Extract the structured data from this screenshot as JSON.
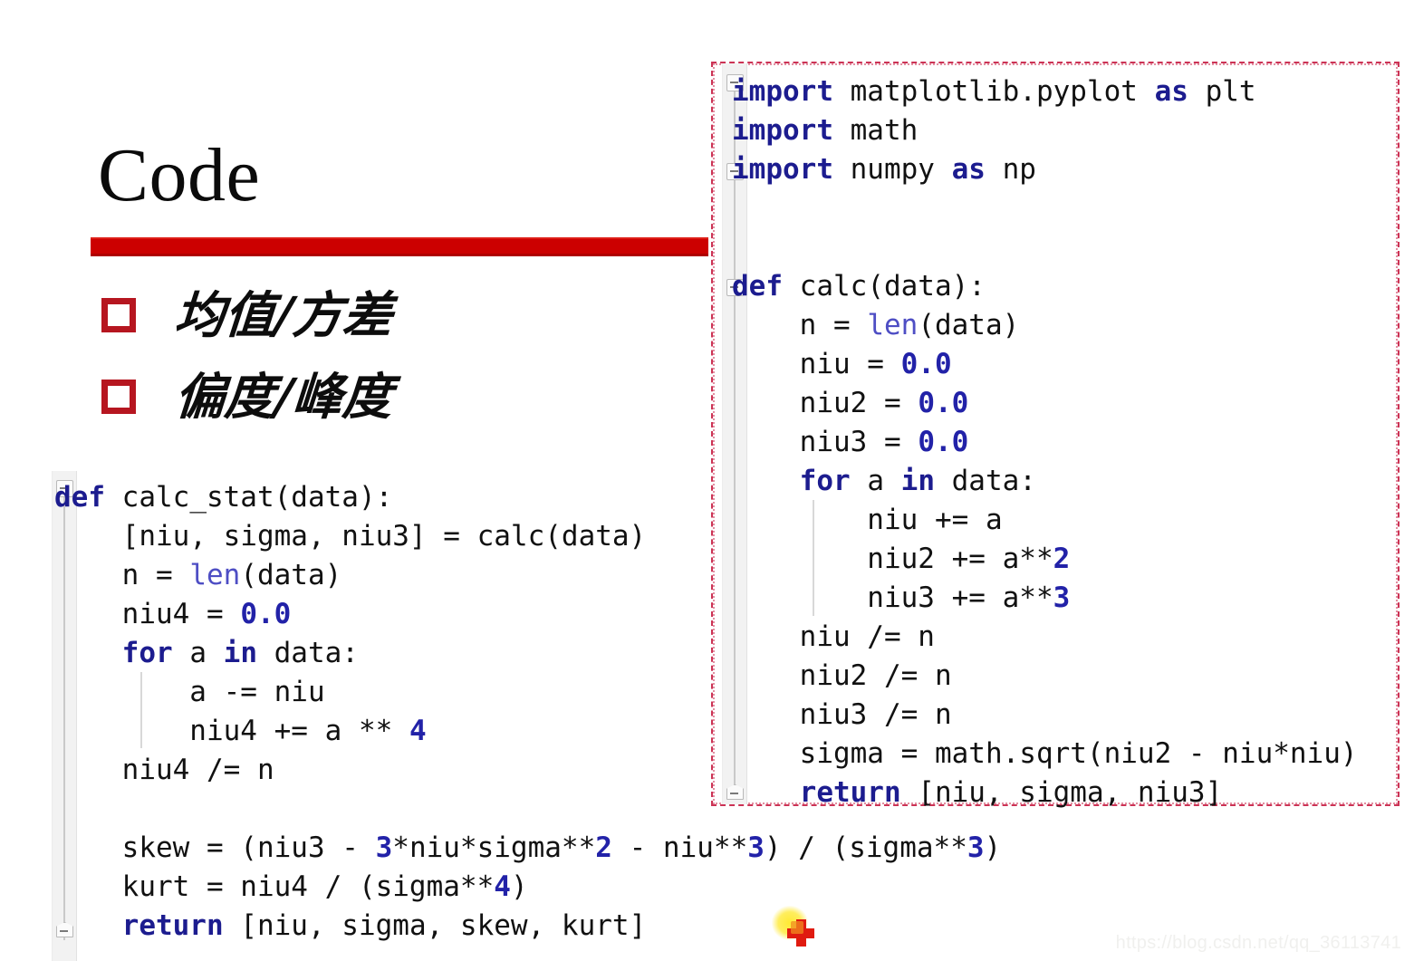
{
  "slide": {
    "title": "Code",
    "accent_color": "#cc0000",
    "bullet_marker_color": "#b61620",
    "background_color": "#ffffff",
    "bullets": [
      {
        "text": "均值/方差"
      },
      {
        "text": "偏度/峰度"
      }
    ]
  },
  "watermark": {
    "text": "https://blog.csdn.net/qq_36113741"
  },
  "cursor": {
    "icon": "red-plus-cursor-icon",
    "glow_color": "#ffe828",
    "cross_color": "#e01b10"
  },
  "syntax_colors": {
    "keyword": "#1c1c8f",
    "builtin": "#4e4ec4",
    "number": "#2222a8",
    "text": "#111111",
    "panel_border": "#cc3355"
  },
  "left_code": {
    "name": "calc_stat-code-block",
    "lines": [
      [
        {
          "t": "def",
          "c": "kw"
        },
        {
          "t": " calc_stat(data):",
          "c": ""
        }
      ],
      [
        {
          "t": "    [niu, sigma, niu3] = calc(data)",
          "c": ""
        }
      ],
      [
        {
          "t": "    n = ",
          "c": ""
        },
        {
          "t": "len",
          "c": "bi"
        },
        {
          "t": "(data)",
          "c": ""
        }
      ],
      [
        {
          "t": "    niu4 = ",
          "c": ""
        },
        {
          "t": "0.0",
          "c": "num"
        }
      ],
      [
        {
          "t": "    ",
          "c": ""
        },
        {
          "t": "for",
          "c": "kw"
        },
        {
          "t": " a ",
          "c": ""
        },
        {
          "t": "in",
          "c": "kw"
        },
        {
          "t": " data:",
          "c": ""
        }
      ],
      [
        {
          "t": "        a -= niu",
          "c": ""
        }
      ],
      [
        {
          "t": "        niu4 += a ** ",
          "c": ""
        },
        {
          "t": "4",
          "c": "num"
        }
      ],
      [
        {
          "t": "    niu4 /= n",
          "c": ""
        }
      ],
      [
        {
          "t": "",
          "c": ""
        }
      ],
      [
        {
          "t": "    skew = (niu3 - ",
          "c": ""
        },
        {
          "t": "3",
          "c": "num"
        },
        {
          "t": "*niu*sigma**",
          "c": ""
        },
        {
          "t": "2",
          "c": "num"
        },
        {
          "t": " - niu**",
          "c": ""
        },
        {
          "t": "3",
          "c": "num"
        },
        {
          "t": ") / (sigma**",
          "c": ""
        },
        {
          "t": "3",
          "c": "num"
        },
        {
          "t": ")",
          "c": ""
        }
      ],
      [
        {
          "t": "    kurt = niu4 / (sigma**",
          "c": ""
        },
        {
          "t": "4",
          "c": "num"
        },
        {
          "t": ")",
          "c": ""
        }
      ],
      [
        {
          "t": "    ",
          "c": ""
        },
        {
          "t": "return",
          "c": "kw"
        },
        {
          "t": " [niu, sigma, skew, kurt]",
          "c": ""
        }
      ]
    ]
  },
  "right_code": {
    "name": "calc-code-block",
    "lines": [
      [
        {
          "t": "import",
          "c": "kw"
        },
        {
          "t": " matplotlib.pyplot ",
          "c": ""
        },
        {
          "t": "as",
          "c": "kw"
        },
        {
          "t": " plt",
          "c": ""
        }
      ],
      [
        {
          "t": "import",
          "c": "kw"
        },
        {
          "t": " math",
          "c": ""
        }
      ],
      [
        {
          "t": "import",
          "c": "kw"
        },
        {
          "t": " numpy ",
          "c": ""
        },
        {
          "t": "as",
          "c": "kw"
        },
        {
          "t": " np",
          "c": ""
        }
      ],
      [
        {
          "t": "",
          "c": ""
        }
      ],
      [
        {
          "t": "",
          "c": ""
        }
      ],
      [
        {
          "t": "def",
          "c": "kw"
        },
        {
          "t": " calc(data):",
          "c": ""
        }
      ],
      [
        {
          "t": "    n = ",
          "c": ""
        },
        {
          "t": "len",
          "c": "bi"
        },
        {
          "t": "(data)",
          "c": ""
        }
      ],
      [
        {
          "t": "    niu = ",
          "c": ""
        },
        {
          "t": "0.0",
          "c": "num"
        }
      ],
      [
        {
          "t": "    niu2 = ",
          "c": ""
        },
        {
          "t": "0.0",
          "c": "num"
        }
      ],
      [
        {
          "t": "    niu3 = ",
          "c": ""
        },
        {
          "t": "0.0",
          "c": "num"
        }
      ],
      [
        {
          "t": "    ",
          "c": ""
        },
        {
          "t": "for",
          "c": "kw"
        },
        {
          "t": " a ",
          "c": ""
        },
        {
          "t": "in",
          "c": "kw"
        },
        {
          "t": " data:",
          "c": ""
        }
      ],
      [
        {
          "t": "        niu += a",
          "c": ""
        }
      ],
      [
        {
          "t": "        niu2 += a**",
          "c": ""
        },
        {
          "t": "2",
          "c": "num"
        }
      ],
      [
        {
          "t": "        niu3 += a**",
          "c": ""
        },
        {
          "t": "3",
          "c": "num"
        }
      ],
      [
        {
          "t": "    niu /= n",
          "c": ""
        }
      ],
      [
        {
          "t": "    niu2 /= n",
          "c": ""
        }
      ],
      [
        {
          "t": "    niu3 /= n",
          "c": ""
        }
      ],
      [
        {
          "t": "    sigma = math.sqrt(niu2 - niu*niu)",
          "c": ""
        }
      ],
      [
        {
          "t": "    ",
          "c": ""
        },
        {
          "t": "return",
          "c": "kw"
        },
        {
          "t": " [niu, sigma, niu3]",
          "c": ""
        }
      ]
    ]
  }
}
